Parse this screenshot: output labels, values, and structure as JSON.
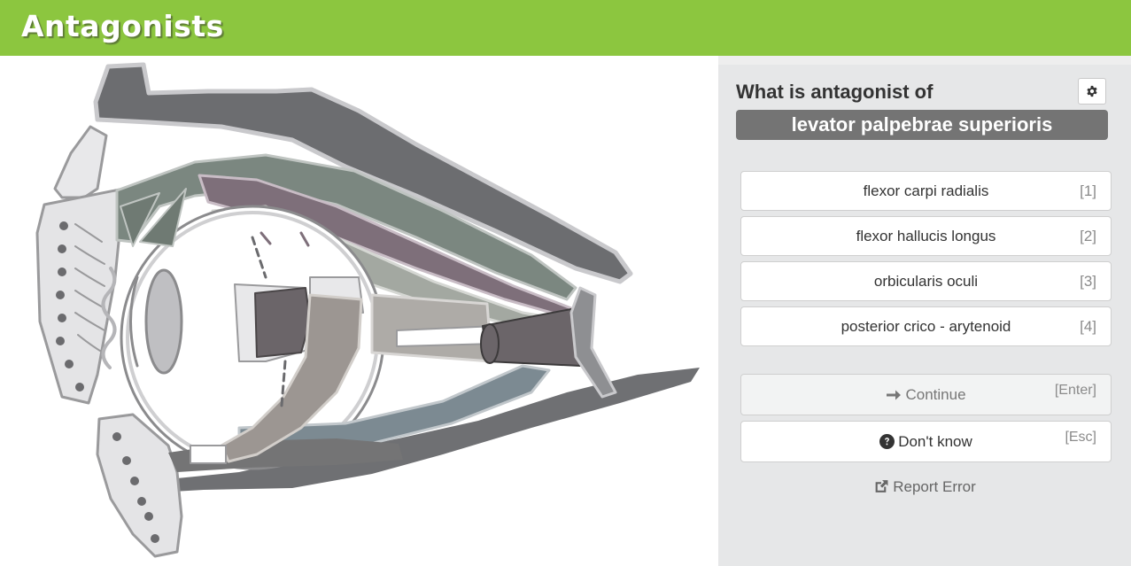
{
  "header": {
    "title": "Antagonists"
  },
  "quiz": {
    "question": "What is antagonist of",
    "term": "levator palpebrae superioris",
    "options": [
      {
        "label": "flexor carpi radialis",
        "key": "[1]"
      },
      {
        "label": "flexor hallucis longus",
        "key": "[2]"
      },
      {
        "label": "orbicularis oculi",
        "key": "[3]"
      },
      {
        "label": "posterior crico - arytenoid",
        "key": "[4]"
      }
    ],
    "continue": {
      "label": "Continue",
      "key": "[Enter]"
    },
    "dont_know": {
      "label": "Don't know",
      "key": "[Esc]"
    },
    "report": "Report Error"
  },
  "icons": {
    "settings": "gear-icon",
    "continue": "arrow-right-icon",
    "dont_know": "question-circle-icon",
    "report": "external-link-icon"
  },
  "colors": {
    "header_bg": "#8cc63f",
    "panel_bg": "#e6e7e8",
    "term_bg": "#747474"
  }
}
